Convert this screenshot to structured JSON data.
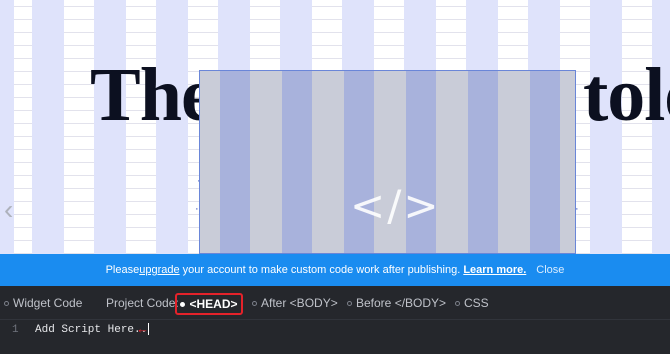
{
  "canvas": {
    "heading_left": "The",
    "heading_right": "tole",
    "prev_glyph": "‹",
    "code_glyph": "</>"
  },
  "notice": {
    "prefix": "Please ",
    "upgrade_link": "upgrade",
    "message": " your account to make custom code work after publishing. ",
    "learn_more": "Learn more.",
    "close": "Close",
    "background": "#1a8cf0"
  },
  "editor": {
    "widget_code_tab": "Widget Code",
    "project_code_label": "Project Code:",
    "tabs": [
      {
        "label": "<HEAD>",
        "active": true
      },
      {
        "label": "After <BODY>",
        "active": false
      },
      {
        "label": "Before </BODY>",
        "active": false
      },
      {
        "label": "CSS",
        "active": false
      }
    ],
    "line_number": "1",
    "code_text": "Add Script Here..",
    "highlight_color": "#e4222a",
    "background": "#25272c"
  }
}
